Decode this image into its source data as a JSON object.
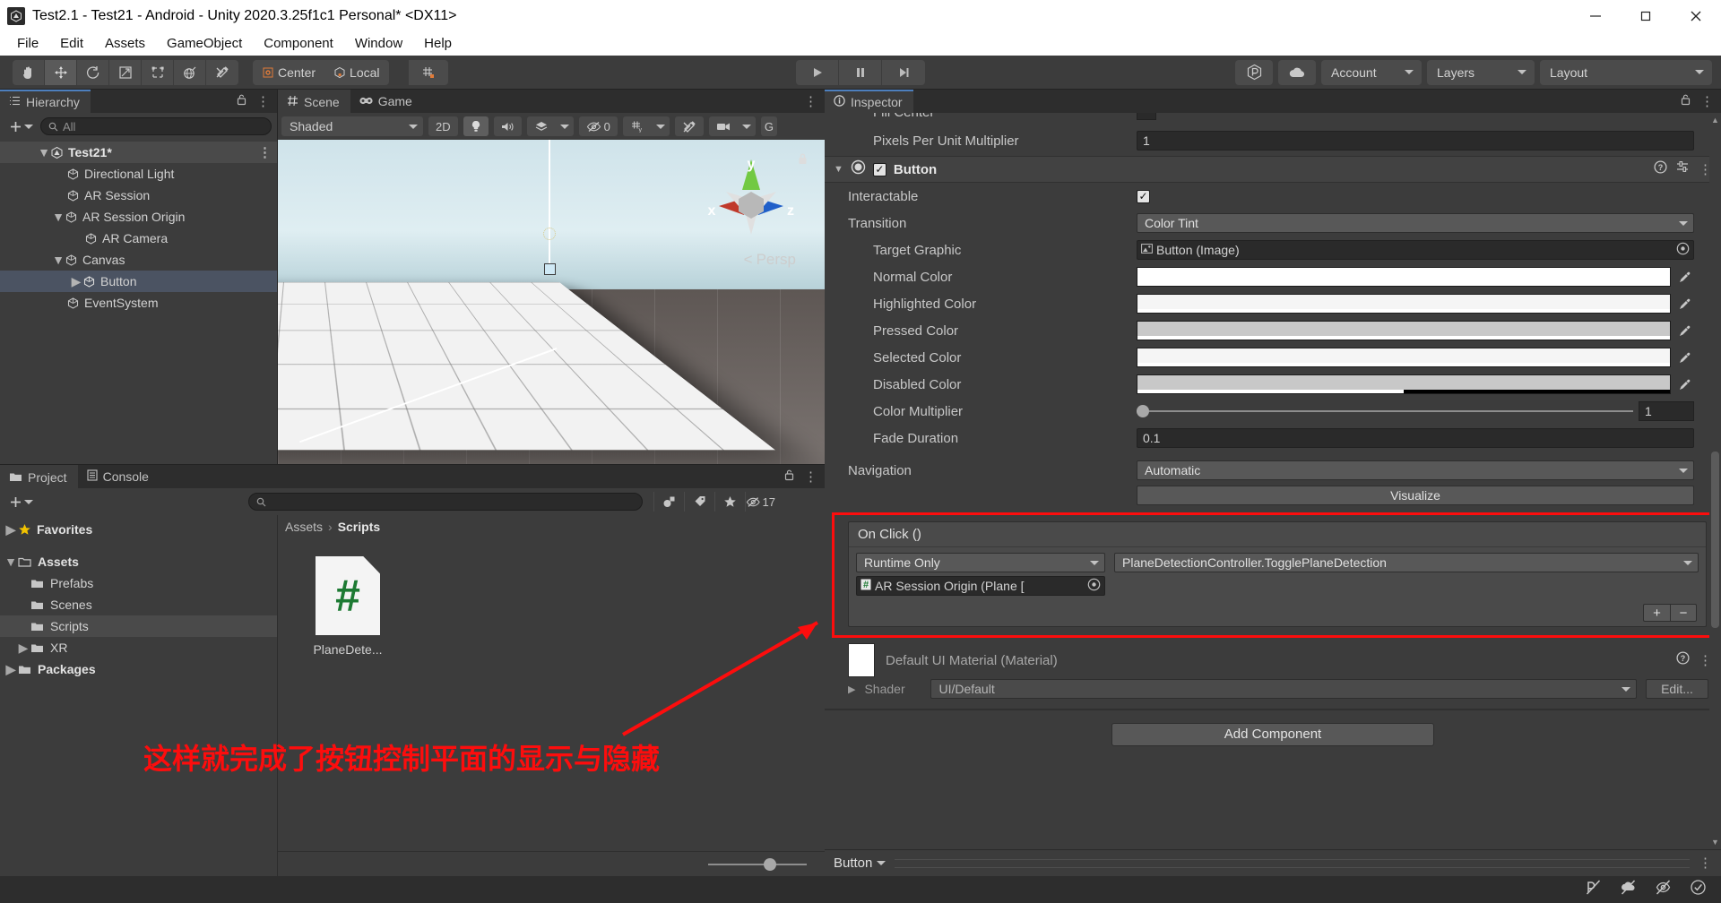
{
  "window": {
    "title": "Test2.1 - Test21 - Android - Unity 2020.3.25f1c1 Personal* <DX11>",
    "app_icon": "unity-icon",
    "minimize": "—",
    "maximize": "❐",
    "close": "✕"
  },
  "menubar": {
    "items": [
      "File",
      "Edit",
      "Assets",
      "GameObject",
      "Component",
      "Window",
      "Help"
    ]
  },
  "toolbar": {
    "tools": [
      {
        "name": "hand-tool-icon",
        "active": false
      },
      {
        "name": "move-tool-icon",
        "active": true
      },
      {
        "name": "rotate-tool-icon",
        "active": false
      },
      {
        "name": "scale-tool-icon",
        "active": false
      },
      {
        "name": "rect-tool-icon",
        "active": false
      },
      {
        "name": "transform-tool-icon",
        "active": false
      },
      {
        "name": "custom-tool-icon",
        "active": false
      }
    ],
    "pivot_label": "Center",
    "space_label": "Local",
    "grid_snap": "grid-snap-icon",
    "play": "▶",
    "pause": "‖",
    "step": "▶|",
    "collab_icon": "plastic-scm-icon",
    "cloud_icon": "cloud-icon",
    "account_label": "Account",
    "layers_label": "Layers",
    "layout_label": "Layout"
  },
  "hierarchy": {
    "tab_label": "Hierarchy",
    "tab_icon": "hierarchy-icon",
    "lock_icon": "lock-icon",
    "menu_icon": "kebab-icon",
    "add_label": "+",
    "search_placeholder": "All",
    "items": [
      {
        "label": "Test21*",
        "depth": 0,
        "twisty": "down",
        "icon": "unity-scene-icon",
        "state": "root"
      },
      {
        "label": "Directional Light",
        "depth": 1,
        "twisty": "",
        "icon": "gameobject-icon",
        "state": ""
      },
      {
        "label": "AR Session",
        "depth": 1,
        "twisty": "",
        "icon": "gameobject-icon",
        "state": ""
      },
      {
        "label": "AR Session Origin",
        "depth": 1,
        "twisty": "down",
        "icon": "gameobject-icon",
        "state": ""
      },
      {
        "label": "AR Camera",
        "depth": 2,
        "twisty": "",
        "icon": "gameobject-icon",
        "state": ""
      },
      {
        "label": "Canvas",
        "depth": 1,
        "twisty": "down",
        "icon": "gameobject-icon",
        "state": ""
      },
      {
        "label": "Button",
        "depth": 2,
        "twisty": "right",
        "icon": "gameobject-icon",
        "state": "selected"
      },
      {
        "label": "EventSystem",
        "depth": 1,
        "twisty": "",
        "icon": "gameobject-icon",
        "state": ""
      }
    ]
  },
  "scene": {
    "tabs": [
      {
        "label": "Scene",
        "icon": "scene-icon",
        "active": true
      },
      {
        "label": "Game",
        "icon": "game-icon",
        "active": false
      }
    ],
    "menu_icon": "kebab-icon",
    "shading_mode": "Shaded",
    "mode_2d": "2D",
    "lighting_icon": "lightbulb-icon",
    "audio_icon": "speaker-icon",
    "fx_icon": "effects-icon",
    "hidden_count": "0",
    "hidden_icon": "eye-off-icon",
    "grid_icon": "grid-axis-icon",
    "tools_icon": "scene-tools-icon",
    "camera_icon": "camera-icon",
    "gizmos_label": "G",
    "gizmo_axes": {
      "x": "x",
      "y": "y",
      "z": "z"
    },
    "projection_label": "Persp"
  },
  "project": {
    "tabs": [
      {
        "label": "Project",
        "icon": "folder-icon",
        "active": true
      },
      {
        "label": "Console",
        "icon": "console-icon",
        "active": false
      }
    ],
    "lock_icon": "lock-icon",
    "menu_icon": "kebab-icon",
    "add_label": "+",
    "search_placeholder": "",
    "filter_icons": [
      "asset-type-filter-icon",
      "label-filter-icon",
      "favorite-filter-icon"
    ],
    "hidden_count": "17",
    "tree": [
      {
        "label": "Favorites",
        "depth": 0,
        "twisty": "right",
        "icon": "star-icon",
        "bold": true,
        "selected": false
      },
      {
        "label": "Assets",
        "depth": 0,
        "twisty": "down",
        "icon": "folder-open-icon",
        "bold": true,
        "selected": false
      },
      {
        "label": "Prefabs",
        "depth": 1,
        "twisty": "",
        "icon": "folder-icon",
        "bold": false,
        "selected": false
      },
      {
        "label": "Scenes",
        "depth": 1,
        "twisty": "",
        "icon": "folder-icon",
        "bold": false,
        "selected": false
      },
      {
        "label": "Scripts",
        "depth": 1,
        "twisty": "",
        "icon": "folder-icon",
        "bold": false,
        "selected": true
      },
      {
        "label": "XR",
        "depth": 1,
        "twisty": "right",
        "icon": "folder-icon",
        "bold": false,
        "selected": false
      },
      {
        "label": "Packages",
        "depth": 0,
        "twisty": "right",
        "icon": "folder-icon",
        "bold": true,
        "selected": false
      }
    ],
    "breadcrumb": [
      "Assets",
      "Scripts"
    ],
    "assets": [
      {
        "name": "PlaneDete...",
        "icon": "csharp-script-icon",
        "glyph": "#"
      }
    ],
    "zoom_value": "56"
  },
  "inspector": {
    "tab_label": "Inspector",
    "tab_icon": "info-icon",
    "lock_icon": "lock-icon",
    "menu_icon": "kebab-icon",
    "clipped_row": {
      "label": "Fill Center"
    },
    "pixels_per_unit": {
      "label": "Pixels Per Unit Multiplier",
      "value": "1"
    },
    "button_component": {
      "title": "Button",
      "enabled": true,
      "toggle_icon": "component-toggle-icon",
      "help_icon": "help-icon",
      "preset_icon": "preset-icon",
      "menu_icon": "kebab-icon",
      "fields": {
        "interactable": {
          "label": "Interactable",
          "checked": true
        },
        "transition": {
          "label": "Transition",
          "value": "Color Tint"
        },
        "target_graphic": {
          "label": "Target Graphic",
          "value": "Button (Image)",
          "icon": "image-component-icon"
        },
        "normal_color": {
          "label": "Normal Color",
          "color": "#ffffff",
          "alpha": 1.0
        },
        "highlighted_color": {
          "label": "Highlighted Color",
          "color": "#f5f5f5",
          "alpha": 1.0
        },
        "pressed_color": {
          "label": "Pressed Color",
          "color": "#c8c8c8",
          "alpha": 1.0
        },
        "selected_color": {
          "label": "Selected Color",
          "color": "#f5f5f5",
          "alpha": 1.0
        },
        "disabled_color": {
          "label": "Disabled Color",
          "color": "#c8c8c8",
          "alpha": 0.5
        },
        "color_multiplier": {
          "label": "Color Multiplier",
          "value": "1",
          "slider_pct": 0
        },
        "fade_duration": {
          "label": "Fade Duration",
          "value": "0.1"
        },
        "navigation": {
          "label": "Navigation",
          "value": "Automatic"
        },
        "visualize": {
          "label": "Visualize"
        }
      }
    },
    "on_click": {
      "title": "On Click ()",
      "highlight_color": "#fd0d0d",
      "entries": [
        {
          "mode": "Runtime Only",
          "function": "PlaneDetectionController.TogglePlaneDetection",
          "object": "AR Session Origin (Plane [",
          "object_icon": "csharp-script-icon"
        }
      ],
      "add_label": "+",
      "remove_label": "−"
    },
    "material": {
      "name": "Default UI Material (Material)",
      "help_icon": "help-icon",
      "menu_icon": "kebab-icon",
      "shader_label": "Shader",
      "shader_value": "UI/Default",
      "edit_label": "Edit..."
    },
    "add_component_label": "Add Component",
    "preview_name": "Button"
  },
  "annotation": {
    "text": "这样就完成了按钮控制平面的显示与隐藏",
    "color": "#fd0d0d",
    "arrow": "arrow-pointing-up-right"
  },
  "statusbar": {
    "icons": [
      "no-collab-icon",
      "no-cloud-icon",
      "no-preview-icon",
      "ok-check-icon"
    ]
  }
}
